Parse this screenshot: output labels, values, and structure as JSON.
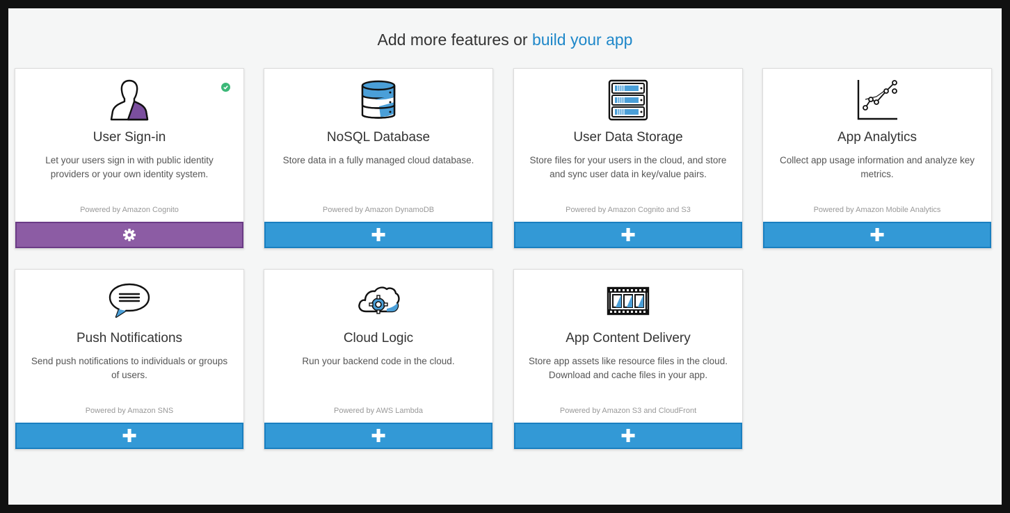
{
  "heading": {
    "prefix": "Add more features or",
    "link": "build your app"
  },
  "colors": {
    "accent": "#1e87c9",
    "add_button": "#3399d6",
    "configured_button": "#8c5ca4",
    "check": "#3cb878"
  },
  "cards": [
    {
      "title": "User Sign-in",
      "desc": "Let your users sign in with public identity providers or your own identity system.",
      "powered": "Powered by Amazon Cognito",
      "icon": "user-silhouette-icon",
      "action": "gear-icon",
      "enabled": true
    },
    {
      "title": "NoSQL Database",
      "desc": "Store data in a fully managed cloud database.",
      "powered": "Powered by Amazon DynamoDB",
      "icon": "database-icon",
      "action": "plus-icon"
    },
    {
      "title": "User Data Storage",
      "desc": "Store files for your users in the cloud, and store and sync user data in key/value pairs.",
      "powered": "Powered by Amazon Cognito and S3",
      "icon": "server-storage-icon",
      "action": "plus-icon"
    },
    {
      "title": "App Analytics",
      "desc": "Collect app usage information and analyze key metrics.",
      "powered": "Powered by Amazon Mobile Analytics",
      "icon": "line-chart-icon",
      "action": "plus-icon"
    },
    {
      "title": "Push Notifications",
      "desc": "Send push notifications to individuals or groups of users.",
      "powered": "Powered by Amazon SNS",
      "icon": "speech-bubble-icon",
      "action": "plus-icon"
    },
    {
      "title": "Cloud Logic",
      "desc": "Run your backend code in the cloud.",
      "powered": "Powered by AWS Lambda",
      "icon": "cloud-gear-icon",
      "action": "plus-icon"
    },
    {
      "title": "App Content Delivery",
      "desc": "Store app assets like resource files in the cloud. Download and cache files in your app.",
      "powered": "Powered by Amazon S3 and CloudFront",
      "icon": "film-strip-icon",
      "action": "plus-icon"
    }
  ]
}
